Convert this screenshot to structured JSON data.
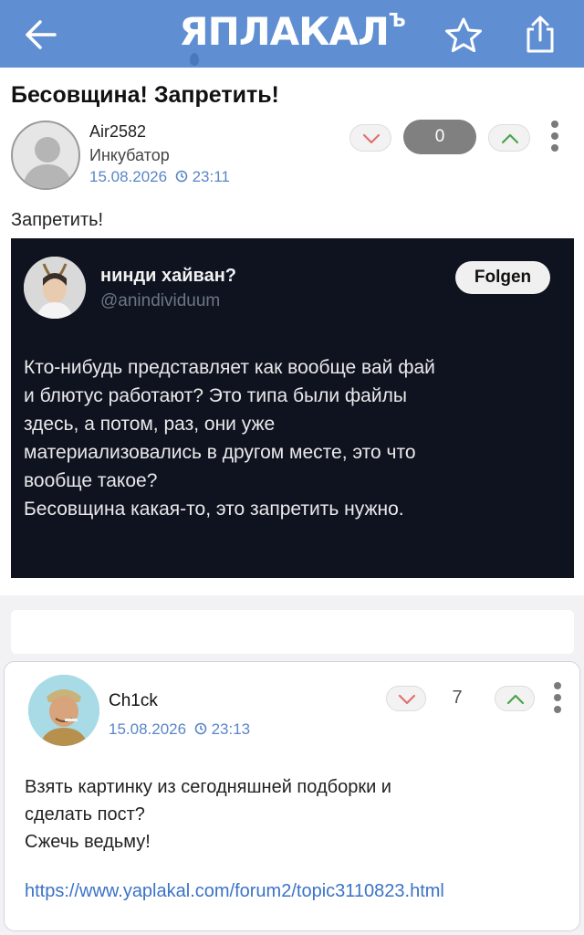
{
  "header": {
    "logo_text": "ЯПЛАКАЛ",
    "logo_mark": "Ъ",
    "brand_color": "#5f8fd2"
  },
  "post": {
    "title": "Бесовщина! Запретить!",
    "author": {
      "name": "Air2582",
      "rank": "Инкубатор",
      "date": "15.08.2026",
      "time": "23:11"
    },
    "score": "0",
    "text": "Запретить!",
    "embedded_tweet": {
      "name": "нинди хайван?",
      "handle": "@anindividuum",
      "follow_label": "Folgen",
      "lines": [
        "Кто-нибудь представляет как вообще вай фай",
        "и блютус работают? Это типа были файлы",
        "здесь, а потом, раз, они уже",
        "материализовались в другом месте, это что",
        "вообще такое?",
        "Бесовщина какая-то, это запретить нужно."
      ]
    }
  },
  "comment": {
    "author": {
      "name": "Ch1ck",
      "date": "15.08.2026",
      "time": "23:13"
    },
    "score": "7",
    "lines": [
      "Взять картинку из сегодняшней подборки и",
      "сделать пост?",
      "Сжечь ведьму!"
    ],
    "link": "https://www.yaplakal.com/forum2/topic3110823.html"
  },
  "icons": {
    "back": "arrow-left-icon",
    "favorite": "star-icon",
    "share": "share-icon",
    "clock": "clock-icon",
    "vote_down": "chevron-down-icon",
    "vote_up": "chevron-up-icon",
    "menu": "more-vertical-icon"
  }
}
